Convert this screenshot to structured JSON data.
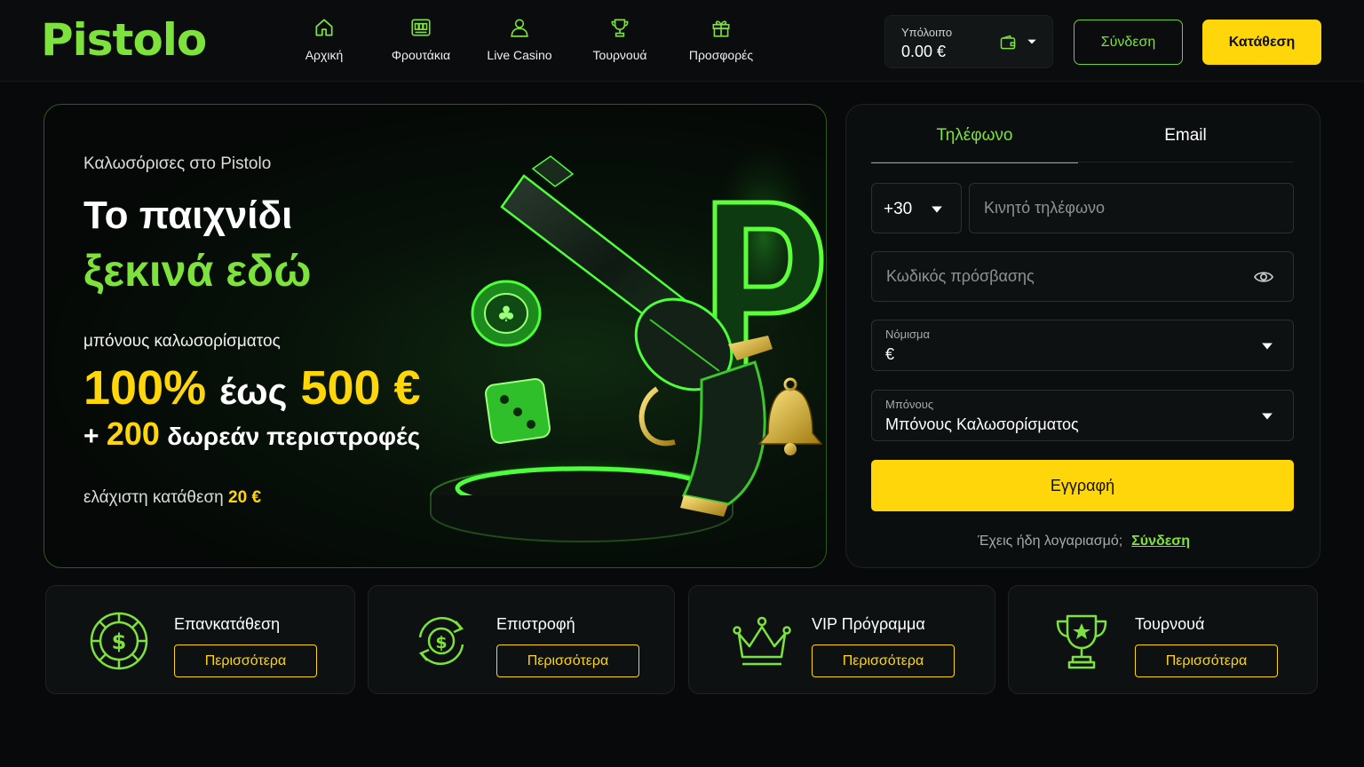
{
  "brand": {
    "logo": "Pistolo"
  },
  "nav": [
    {
      "label": "Αρχική",
      "icon": "home-icon"
    },
    {
      "label": "Φρουτάκια",
      "icon": "slot-machine-icon"
    },
    {
      "label": "Live Casino",
      "icon": "dealer-icon"
    },
    {
      "label": "Τουρνουά",
      "icon": "trophy-icon"
    },
    {
      "label": "Προσφορές",
      "icon": "gift-icon"
    }
  ],
  "balance": {
    "label": "Υπόλοιπο",
    "value": "0.00 €"
  },
  "header_buttons": {
    "login": "Σύνδεση",
    "deposit": "Κατάθεση"
  },
  "hero": {
    "welcome": "Καλωσόρισες στο Pistolo",
    "title_line1": "Το παιχνίδι",
    "title_line2": "ξεκινά εδώ",
    "bonus_label": "μπόνους καλωσορίσματος",
    "bonus_percent": "100%",
    "bonus_upto": "έως",
    "bonus_amount": "500 €",
    "spins_plus": "+",
    "spins_count": "200",
    "spins_text": "δωρεάν περιστροφές",
    "min_deposit_label": "ελάχιστη κατάθεση",
    "min_deposit_value": "20 €"
  },
  "register": {
    "tabs": [
      "Τηλέφωνο",
      "Email"
    ],
    "active_tab": "Τηλέφωνο",
    "country_code": "+30",
    "phone_placeholder": "Κινητό τηλέφωνο",
    "password_placeholder": "Κωδικός πρόσβασης",
    "currency_label": "Νόμισμα",
    "currency_value": "€",
    "bonus_label": "Μπόνους",
    "bonus_value": "Μπόνους Καλωσορίσματος",
    "submit": "Εγγραφή",
    "has_account": "Έχεις ήδη λογαριασμό;",
    "login_link": "Σύνδεση"
  },
  "cards": [
    {
      "title": "Επανκατάθεση",
      "button": "Περισσότερα",
      "icon": "casino-chip-dollar-icon"
    },
    {
      "title": "Επιστροφή",
      "button": "Περισσότερα",
      "icon": "cashback-icon"
    },
    {
      "title": "VIP Πρόγραμμα",
      "button": "Περισσότερα",
      "icon": "crown-icon"
    },
    {
      "title": "Τουρνουά",
      "button": "Περισσότερα",
      "icon": "trophy-icon"
    }
  ],
  "colors": {
    "accent_green": "#7ee23d",
    "accent_yellow": "#ffd60a",
    "background": "#07090a"
  }
}
